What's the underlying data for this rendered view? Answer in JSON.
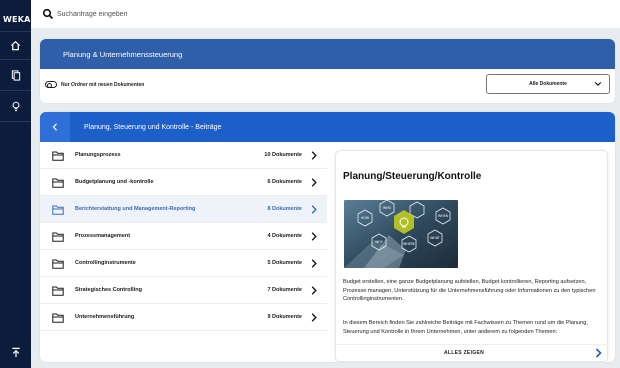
{
  "brand": {
    "logo": "WEKA"
  },
  "search": {
    "placeholder": "Suchanfrage eingeben"
  },
  "rail": {
    "icons": [
      "home-icon",
      "document-icon",
      "lightbulb-icon",
      "scroll-top-icon"
    ]
  },
  "section": {
    "title": "Planung & Unternehmenssteuerung",
    "toggle_label": "Nur Ordner mit neuen Dokumenten",
    "select_value": "Alle Dokumente"
  },
  "panel": {
    "title": "Planung, Steuerung und Kontrolle - Beiträge",
    "rows": [
      {
        "label": "Planungsprozess",
        "count": "10 Dokumente"
      },
      {
        "label": "Budgetplanung und -kontrolle",
        "count": "6 Dokumente"
      },
      {
        "label": "Berichterstattung und Management-Reporting",
        "count": "8 Dokumente"
      },
      {
        "label": "Prozessmanagement",
        "count": "4 Dokumente"
      },
      {
        "label": "Controllinginstrumente",
        "count": "5 Dokumente"
      },
      {
        "label": "Strategisches Controlling",
        "count": "7 Dokumente"
      },
      {
        "label": "Unternehmensführung",
        "count": "9 Dokumente"
      }
    ],
    "active_row": 2
  },
  "detail": {
    "title": "Planung/Steuerung/Kontrolle",
    "image_words": [
      "HOW",
      "WHO",
      "WHEN",
      "WHAT",
      "WHY",
      "WHERE"
    ],
    "paragraph1": "Budget erstellen, eine ganze Budgetplanung aufstellen, Budget kontrollieren, Reporting aufsetzen, Prozesse managen, Unterstützung für die Unternehmensführung oder Informationen zu den typischen Controllinginstrumenten.",
    "paragraph2": "In diesem Bereich finden Sie zahlreiche Beiträge mit Fachwissen zu Themen rund um die Planung, Steuerung und Kontrolle in Ihrem Unternehmen, unter anderem zu folgenden Themen:",
    "more_label": "ALLES ZEIGEN"
  },
  "colors": {
    "rail": "#0b1c3d",
    "header": "#2e5fa8",
    "panel_header": "#1c5fc9",
    "active_text": "#3b6bb6"
  }
}
